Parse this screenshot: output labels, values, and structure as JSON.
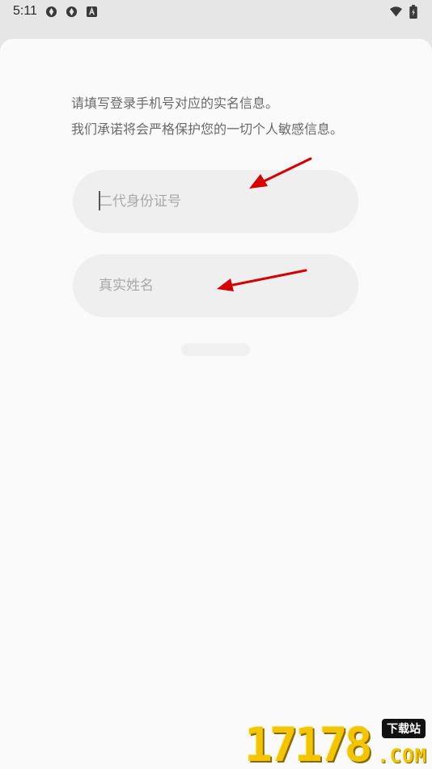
{
  "status_bar": {
    "time": "5:11",
    "icons": [
      "sync-icon",
      "sync-icon",
      "keyboard-icon"
    ],
    "right_icons": [
      "wifi-icon",
      "battery-icon"
    ]
  },
  "intro": {
    "line1": "请填写登录手机号对应的实名信息。",
    "line2": "我们承诺将会严格保护您的一切个人敏感信息。"
  },
  "form": {
    "id_number": {
      "placeholder": "二代身份证号",
      "value": ""
    },
    "real_name": {
      "placeholder": "真实姓名",
      "value": ""
    }
  },
  "watermark": {
    "digits": "17178",
    "badge": "下载站",
    "suffix": ".COM"
  },
  "colors": {
    "sheet_bg": "#fafafa",
    "field_bg": "#efefef",
    "arrow": "#d40000",
    "watermark": "#f3c400"
  }
}
